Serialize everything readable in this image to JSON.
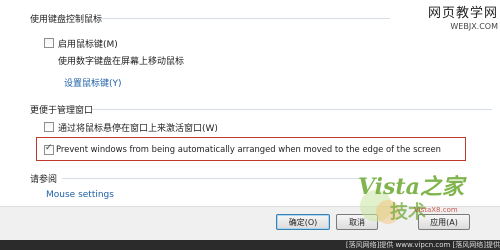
{
  "sections": {
    "keyboard": {
      "title": "使用键盘控制鼠标",
      "mouse_keys_label": "启用鼠标键(M)",
      "mouse_keys_checked": false,
      "mouse_keys_desc": "使用数字键盘在屏幕上移动鼠标",
      "setup_link": "设置鼠标键(Y)"
    },
    "window_management": {
      "title": "更便于管理窗口",
      "hover_activate_label": "通过将鼠标悬停在窗口上来激活窗口(W)",
      "hover_activate_checked": false,
      "prevent_arrange_label": "Prevent windows from being automatically arranged when moved to the edge of the screen",
      "prevent_arrange_checked": true
    },
    "see_also": {
      "title": "请参阅",
      "mouse_settings_link": "Mouse settings"
    }
  },
  "footer": {
    "ok_label": "确定(O)",
    "cancel_label": "取消",
    "apply_label": "应用(A)"
  },
  "watermarks": {
    "top_right_line1": "网页教学网",
    "top_right_line2": "WEBJX.COM",
    "vista_text": "Vista之家",
    "vista_sub": "技术",
    "vista_url": "VistaX8.com",
    "status_bar": "[落风网络]提供 www.vipcn.com [落风网络]提供"
  },
  "colors": {
    "highlight_border": "#c0392b",
    "link": "#1f5fa6"
  }
}
